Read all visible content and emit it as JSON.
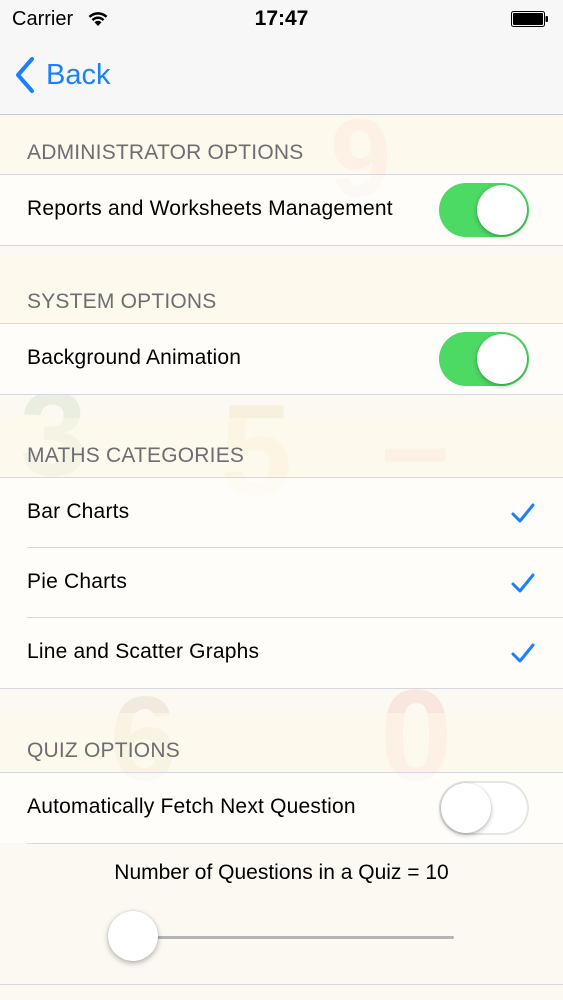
{
  "status_bar": {
    "carrier": "Carrier",
    "time": "17:47"
  },
  "nav": {
    "back_label": "Back"
  },
  "sections": {
    "admin": {
      "header": "ADMINISTRATOR OPTIONS",
      "reports_label": "Reports and Worksheets Management",
      "reports_on": true
    },
    "system": {
      "header": "SYSTEM OPTIONS",
      "animation_label": "Background Animation",
      "animation_on": true
    },
    "maths": {
      "header": "MATHS CATEGORIES",
      "items": [
        {
          "label": "Bar Charts",
          "checked": true
        },
        {
          "label": "Pie Charts",
          "checked": true
        },
        {
          "label": "Line and Scatter Graphs",
          "checked": true
        }
      ]
    },
    "quiz": {
      "header": "QUIZ OPTIONS",
      "auto_fetch_label": "Automatically Fetch Next Question",
      "auto_fetch_on": false,
      "questions_label": "Number of Questions in a Quiz = 10",
      "questions_slider_fraction": 0
    }
  },
  "colors": {
    "accent": "#1a80ff",
    "switch_on": "#4cd964",
    "header_text": "#6d6d72"
  },
  "icons": {
    "back": "chevron-left-icon",
    "wifi": "wifi-icon",
    "battery": "battery-icon",
    "check": "checkmark-icon"
  }
}
